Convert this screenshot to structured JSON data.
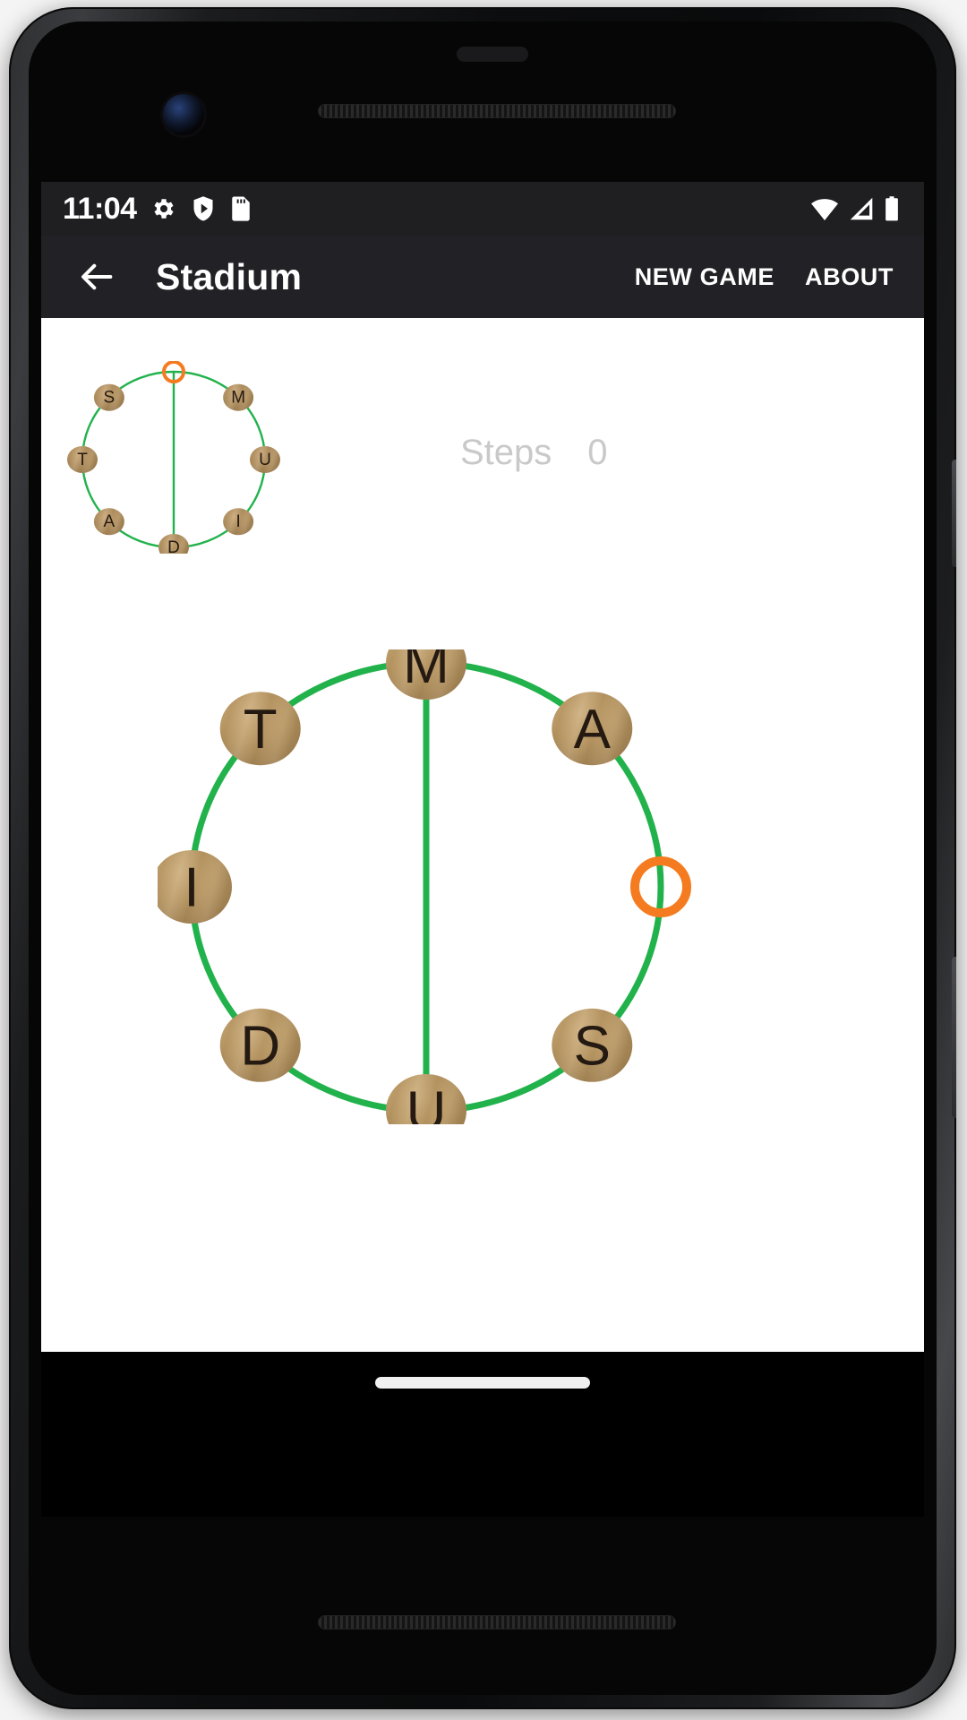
{
  "status_bar": {
    "time": "11:04",
    "left_icons": [
      "gear-icon",
      "shield-play-icon",
      "sd-card-icon"
    ],
    "right_icons": [
      "wifi-icon",
      "cell-signal-icon",
      "battery-icon"
    ],
    "background_color": "#1f1f22",
    "foreground_color": "#ffffff"
  },
  "app_bar": {
    "back_icon": "back-arrow-icon",
    "title": "Stadium",
    "actions": [
      {
        "label": "NEW GAME",
        "name": "new-game"
      },
      {
        "label": "ABOUT",
        "name": "about"
      }
    ],
    "background_color": "#222226",
    "text_color": "#ffffff"
  },
  "content": {
    "background_color": "#ffffff",
    "steps": {
      "label": "Steps",
      "value": "0",
      "text_color": "#c9c9c9"
    },
    "colors": {
      "track": "#22b24c",
      "empty_slot": "#f47b20",
      "tile_face": "#b79461",
      "tile_letter": "#241a12"
    },
    "goal_board": {
      "name": "goal-preview-board",
      "slots": [
        {
          "position": "top",
          "angle": 270,
          "label": "",
          "empty": true
        },
        {
          "position": "top-right",
          "angle": 315,
          "label": "M",
          "empty": false
        },
        {
          "position": "right",
          "angle": 0,
          "label": "U",
          "empty": false
        },
        {
          "position": "bottom-right",
          "angle": 45,
          "label": "I",
          "empty": false
        },
        {
          "position": "bottom",
          "angle": 90,
          "label": "D",
          "empty": false
        },
        {
          "position": "bottom-left",
          "angle": 135,
          "label": "A",
          "empty": false
        },
        {
          "position": "left",
          "angle": 180,
          "label": "T",
          "empty": false
        },
        {
          "position": "top-left",
          "angle": 225,
          "label": "S",
          "empty": false
        }
      ]
    },
    "play_board": {
      "name": "play-board",
      "slots": [
        {
          "position": "top",
          "angle": 270,
          "label": "M",
          "empty": false
        },
        {
          "position": "top-right",
          "angle": 315,
          "label": "A",
          "empty": false
        },
        {
          "position": "right",
          "angle": 0,
          "label": "",
          "empty": true
        },
        {
          "position": "bottom-right",
          "angle": 45,
          "label": "S",
          "empty": false
        },
        {
          "position": "bottom",
          "angle": 90,
          "label": "U",
          "empty": false
        },
        {
          "position": "bottom-left",
          "angle": 135,
          "label": "D",
          "empty": false
        },
        {
          "position": "left",
          "angle": 180,
          "label": "I",
          "empty": false
        },
        {
          "position": "top-left",
          "angle": 225,
          "label": "T",
          "empty": false
        }
      ]
    }
  },
  "nav_bar": {
    "home_indicator": "home-indicator",
    "background_color": "#000000"
  }
}
